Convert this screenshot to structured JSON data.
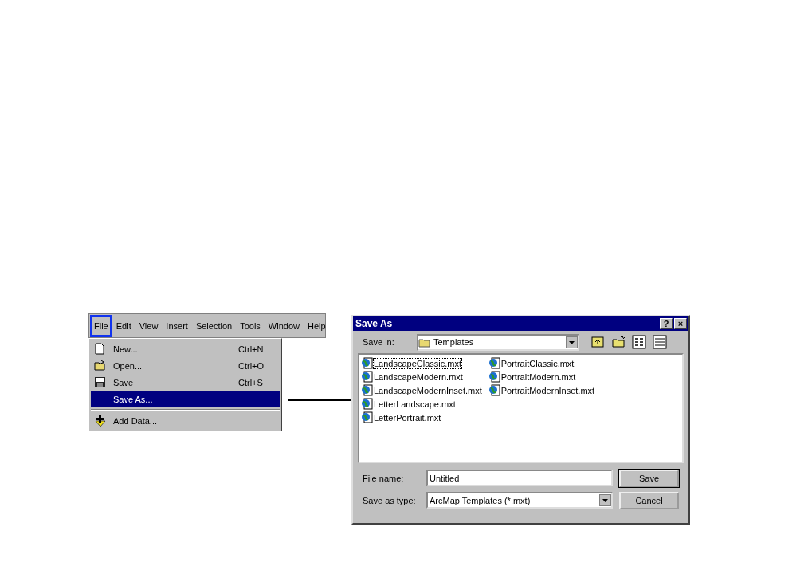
{
  "menu_bar": {
    "items": [
      {
        "label": "File",
        "selected": true
      },
      {
        "label": "Edit",
        "selected": false
      },
      {
        "label": "View",
        "selected": false
      },
      {
        "label": "Insert",
        "selected": false
      },
      {
        "label": "Selection",
        "selected": false
      },
      {
        "label": "Tools",
        "selected": false
      },
      {
        "label": "Window",
        "selected": false
      },
      {
        "label": "Help",
        "selected": false
      }
    ]
  },
  "file_menu": {
    "items": [
      {
        "kind": "item",
        "label": "New...",
        "shortcut": "Ctrl+N",
        "selected": false
      },
      {
        "kind": "item",
        "label": "Open...",
        "shortcut": "Ctrl+O",
        "selected": false
      },
      {
        "kind": "item",
        "label": "Save",
        "shortcut": "Ctrl+S",
        "selected": false
      },
      {
        "kind": "item",
        "label": "Save As...",
        "selected": true
      },
      {
        "kind": "separator"
      },
      {
        "kind": "item",
        "label": "Add Data...",
        "selected": false
      }
    ]
  },
  "dialog": {
    "title": "Save As",
    "help_button": "?",
    "close_button": "×",
    "save_in": {
      "label": "Save in:",
      "value": "Templates"
    },
    "files": [
      {
        "name": "LandscapeClassic.mxt",
        "focused": true
      },
      {
        "name": "LandscapeModern.mxt",
        "focused": false
      },
      {
        "name": "LandscapeModernInset.mxt",
        "focused": false
      },
      {
        "name": "LetterLandscape.mxt",
        "focused": false
      },
      {
        "name": "LetterPortrait.mxt",
        "focused": false
      },
      {
        "name": "PortraitClassic.mxt",
        "focused": false
      },
      {
        "name": "PortraitModern.mxt",
        "focused": false
      },
      {
        "name": "PortraitModernInset.mxt",
        "focused": false
      }
    ],
    "file_name": {
      "label": "File name:",
      "value": "Untitled"
    },
    "save_as_type": {
      "label": "Save as type:",
      "value": "ArcMap Templates (*.mxt)"
    },
    "buttons": [
      "Save",
      "Cancel"
    ]
  }
}
